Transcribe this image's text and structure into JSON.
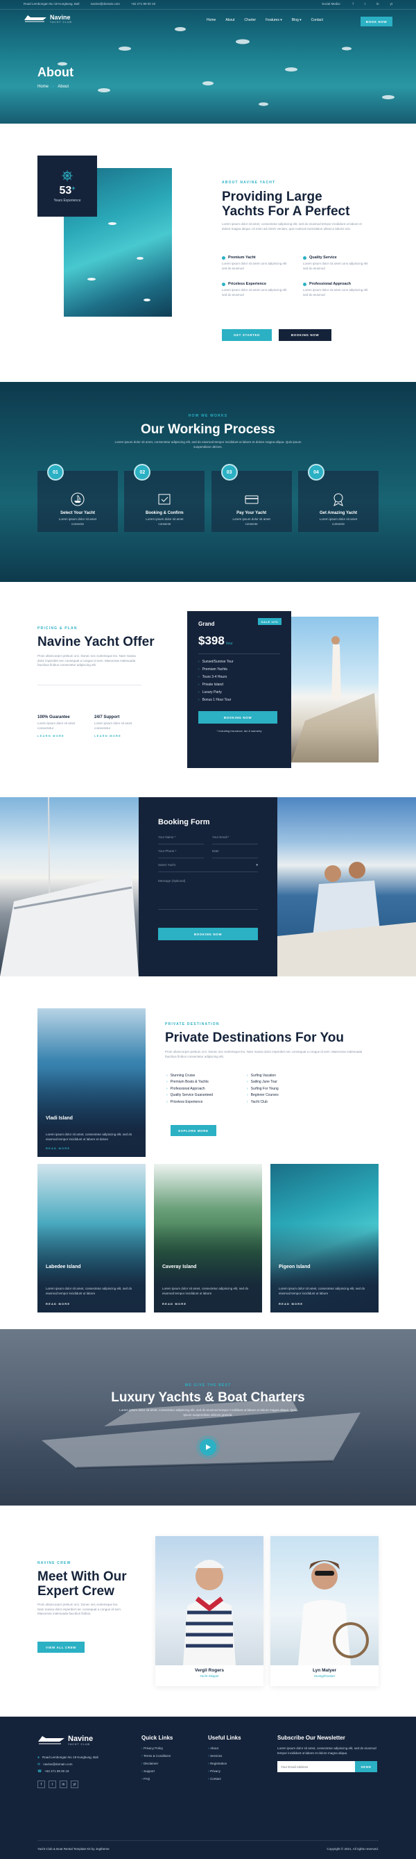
{
  "topbar": {
    "address": "Road Lembongan No 19 Kungkung, Bali",
    "email": "navine@domain.com",
    "phone": "+62 271 89 00 19",
    "social_label": "Social Media :",
    "social_icons": [
      "f",
      "t",
      "in",
      "yt"
    ]
  },
  "brand": {
    "name": "Navine",
    "tagline": "YACHT CLUB"
  },
  "nav": {
    "items": [
      "Home",
      "About",
      "Charter",
      "Features ▾",
      "Blog ▾",
      "Contact"
    ],
    "cta": "BOOK NOW"
  },
  "hero": {
    "title": "About",
    "crumb_home": "Home",
    "crumb_sep": "»",
    "crumb_current": "About"
  },
  "about": {
    "badge_number": "53",
    "badge_plus": "+",
    "badge_label": "Years Experience",
    "eyebrow": "ABOUT NAVINE YACHT",
    "title_line1": "Providing Large",
    "title_line2": "Yachts For A Perfect",
    "desc": "Lorem ipsum dolor sit amet, consectetur adipiscing elit, sed do eiusmod tempor incididunt ut labore et dolore magna aliqua. Ut enim ad minim veniam, quis nostrud exercitation ullamco laboris nisi.",
    "features": [
      {
        "title": "Premium Yacht",
        "desc": "Lorem ipsum dolor sit amet cons adipiscing elit sed do eiusmod"
      },
      {
        "title": "Quality Service",
        "desc": "Lorem ipsum dolor sit amet cons adipiscing elit sed do eiusmod"
      },
      {
        "title": "Priceless Experience",
        "desc": "Lorem ipsum dolor sit amet cons adipiscing elit sed do eiusmod"
      },
      {
        "title": "Professional Approach",
        "desc": "Lorem ipsum dolor sit amet cons adipiscing elit sed do eiusmod"
      }
    ],
    "btn_primary": "GET STARTED",
    "btn_secondary": "BOOKING NOW"
  },
  "process": {
    "eyebrow": "HOW WE WORKS",
    "title": "Our Working Process",
    "desc": "Lorem ipsum dolor sit amet, consectetur adipiscing elit, sed do eiusmod tempor incididunt ut labore et dolore magna aliqua. Quis ipsum suspendisse ultrices.",
    "steps": [
      {
        "num": "01",
        "title": "Select Your Yacht",
        "desc": "Lorem ipsum dolor sit amet consecte"
      },
      {
        "num": "02",
        "title": "Booking & Confirm",
        "desc": "Lorem ipsum dolor sit amet consecte"
      },
      {
        "num": "03",
        "title": "Pay Your Yacht",
        "desc": "Lorem ipsum dolor sit amet consecte"
      },
      {
        "num": "04",
        "title": "Get Amazing Yacht",
        "desc": "Lorem ipsum dolor sit amet consecte"
      }
    ]
  },
  "offer": {
    "eyebrow": "PRICING & PLAN",
    "title": "Navine Yacht Offer",
    "desc": "Proin ullamcorper pretium orci. Donec nec scelerisque leo. Nam massa dolor imperdiet nec consequat a congue id sem. Maecenas malesuada faucibus finibus consectetur adipiscing elit.",
    "features": [
      {
        "title": "100% Guarantee",
        "desc": "Lorem ipsum dolor sit amet consectetur",
        "link": "LEARN MORE"
      },
      {
        "title": "24/7 Support",
        "desc": "Lorem ipsum dolor sit amet consectetur",
        "link": "LEARN MORE"
      }
    ],
    "card": {
      "plan": "Grand",
      "badge": "SALE 10%",
      "price": "$398",
      "per": "/tour",
      "items": [
        "Sunset/Sunrise Tour",
        "Premium Yachts",
        "Tours 3-4 Hours",
        "Private Island",
        "Luxury Party",
        "Bonus 1 Hour Tour"
      ],
      "button": "BOOKING NOW",
      "note": "* Including insurance, tax & warranty"
    }
  },
  "booking": {
    "title": "Booking Form",
    "fields": [
      "Your Name *",
      "Your Email *",
      "Your Phone *",
      "Date",
      "Select Yacht",
      "Message (Optional)"
    ],
    "button": "BOOKING NOW"
  },
  "destinations": {
    "eyebrow": "PRIVATE DESTINATION",
    "title": "Private Destinations For You",
    "desc": "Proin ullamcorper pretium orci. Donec nec scelerisque leo. Nam massa dolor imperdiet nec consequat a congue id sem. Maecenas malesuada faucibus finibus consectetur adipiscing elit.",
    "list_left": [
      "Stunning Cruise",
      "Premium Boats & Yachts",
      "Professional Approach",
      "Quality Service Guaranteed",
      "Priceless Experience"
    ],
    "list_right": [
      "Surfing Vacation",
      "Sailing June Tour",
      "Surfing For Young",
      "Beginner Courses",
      "Yacht Club"
    ],
    "button": "EXPLORE MORE",
    "featured": {
      "name": "Vladi Island",
      "desc": "Lorem ipsum dolor sit amet, consectetur adipiscing elit, sed do eiusmod tempor incididunt ut labore et dolore",
      "link": "READ MORE"
    },
    "cards": [
      {
        "name": "Labedee Island",
        "desc": "Lorem ipsum dolor sit amet, consectetur adipiscing elit, sed do eiusmod tempor incididunt ut labore",
        "link": "READ MORE"
      },
      {
        "name": "Caveray Island",
        "desc": "Lorem ipsum dolor sit amet, consectetur adipiscing elit, sed do eiusmod tempor incididunt ut labore",
        "link": "READ MORE"
      },
      {
        "name": "Pigeon Island",
        "desc": "Lorem ipsum dolor sit amet, consectetur adipiscing elit, sed do eiusmod tempor incididunt ut labore",
        "link": "READ MORE"
      }
    ]
  },
  "video": {
    "eyebrow": "WE GIVE THE BEST",
    "title": "Luxury Yachts & Boat Charters",
    "desc": "Lorem ipsum dolor sit amet, consectetur adipiscing elit, sed do eiusmod tempor incididunt ut labore et dolore magna aliqua. Quis ipsum suspendisse ultrices gravida."
  },
  "crew": {
    "eyebrow": "NAVINE CREW",
    "title_line1": "Meet With Our",
    "title_line2": "Expert Crew",
    "desc": "Proin ullamcorper pretium orci. Donec nec scelerisque leo. Nam massa dolor imperdiet nec consequat a congue id sem. Maecenas malesuada faucibus finibus.",
    "button": "VIEW ALL CREW",
    "members": [
      {
        "name": "Vergil Rogers",
        "role": "Yacht Skipper"
      },
      {
        "name": "Lyn Matyer",
        "role": "Stuntgirlmaster"
      }
    ]
  },
  "footer": {
    "brand": "Navine",
    "tagline": "YACHT CLUB",
    "address": "Road Lembongan No 19 Kungkung, Bali",
    "email": "navine@domain.com",
    "phone": "+62 271 89 00 19",
    "quick_title": "Quick Links",
    "quick": [
      "Privacy Policy",
      "Terms & Conditions",
      "Disclaimer",
      "Support",
      "FAQ"
    ],
    "useful_title": "Useful Links",
    "useful": [
      "About",
      "Services",
      "Registration",
      "Privacy",
      "Contact"
    ],
    "news_title": "Subscribe Our Newsletter",
    "news_desc": "Lorem ipsum dolor sit amet, consectetur adipiscing elit, sed do eiusmod tempor incididunt ut labore et dolore magna aliqua.",
    "news_placeholder": "Your Email Address",
    "news_button": "SEND",
    "bottom_left": "Yacht Club & Boat Rental Template Kit by Jegtheme",
    "bottom_right": "Copyright © 2021, All rights reserved."
  },
  "colors": {
    "accent": "#2bb0c4",
    "navy": "#15233a"
  }
}
